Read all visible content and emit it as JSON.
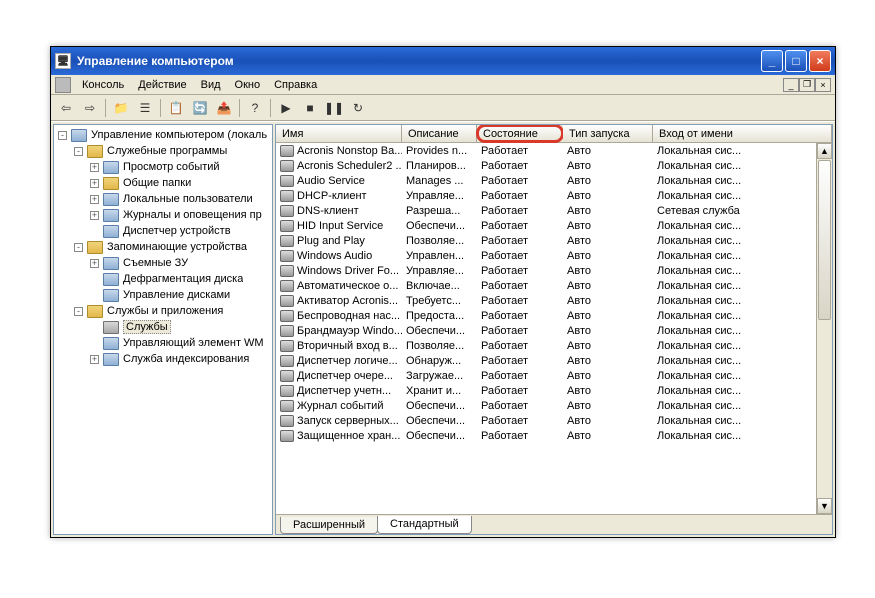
{
  "titlebar": {
    "title": "Управление компьютером"
  },
  "menu": [
    "Консоль",
    "Действие",
    "Вид",
    "Окно",
    "Справка"
  ],
  "tree": [
    {
      "depth": 0,
      "exp": "-",
      "icon": "device",
      "label": "Управление компьютером (локаль"
    },
    {
      "depth": 1,
      "exp": "-",
      "icon": "folder",
      "label": "Служебные программы"
    },
    {
      "depth": 2,
      "exp": "+",
      "icon": "device",
      "label": "Просмотр событий"
    },
    {
      "depth": 2,
      "exp": "+",
      "icon": "folder",
      "label": "Общие папки"
    },
    {
      "depth": 2,
      "exp": "+",
      "icon": "device",
      "label": "Локальные пользователи"
    },
    {
      "depth": 2,
      "exp": "+",
      "icon": "device",
      "label": "Журналы и оповещения пр"
    },
    {
      "depth": 2,
      "exp": " ",
      "icon": "device",
      "label": "Диспетчер устройств"
    },
    {
      "depth": 1,
      "exp": "-",
      "icon": "folder",
      "label": "Запоминающие устройства"
    },
    {
      "depth": 2,
      "exp": "+",
      "icon": "device",
      "label": "Съемные ЗУ"
    },
    {
      "depth": 2,
      "exp": " ",
      "icon": "device",
      "label": "Дефрагментация диска"
    },
    {
      "depth": 2,
      "exp": " ",
      "icon": "device",
      "label": "Управление дисками"
    },
    {
      "depth": 1,
      "exp": "-",
      "icon": "folder",
      "label": "Службы и приложения"
    },
    {
      "depth": 2,
      "exp": " ",
      "icon": "service",
      "label": "Службы",
      "selected": true
    },
    {
      "depth": 2,
      "exp": " ",
      "icon": "device",
      "label": "Управляющий элемент WM"
    },
    {
      "depth": 2,
      "exp": "+",
      "icon": "device",
      "label": "Служба индексирования"
    }
  ],
  "columns": {
    "name": "Имя",
    "desc": "Описание",
    "status": "Состояние",
    "startup": "Тип запуска",
    "logon": "Вход от имени"
  },
  "services": [
    {
      "name": "Acronis Nonstop Ba...",
      "desc": "Provides n...",
      "status": "Работает",
      "startup": "Авто",
      "logon": "Локальная сис..."
    },
    {
      "name": "Acronis Scheduler2 ...",
      "desc": "Планиров...",
      "status": "Работает",
      "startup": "Авто",
      "logon": "Локальная сис..."
    },
    {
      "name": "Audio Service",
      "desc": "Manages ...",
      "status": "Работает",
      "startup": "Авто",
      "logon": "Локальная сис..."
    },
    {
      "name": "DHCP-клиент",
      "desc": "Управляе...",
      "status": "Работает",
      "startup": "Авто",
      "logon": "Локальная сис..."
    },
    {
      "name": "DNS-клиент",
      "desc": "Разреша...",
      "status": "Работает",
      "startup": "Авто",
      "logon": "Сетевая служба"
    },
    {
      "name": "HID Input Service",
      "desc": "Обеспечи...",
      "status": "Работает",
      "startup": "Авто",
      "logon": "Локальная сис..."
    },
    {
      "name": "Plug and Play",
      "desc": "Позволяе...",
      "status": "Работает",
      "startup": "Авто",
      "logon": "Локальная сис..."
    },
    {
      "name": "Windows Audio",
      "desc": "Управлен...",
      "status": "Работает",
      "startup": "Авто",
      "logon": "Локальная сис..."
    },
    {
      "name": "Windows Driver Fo...",
      "desc": "Управляе...",
      "status": "Работает",
      "startup": "Авто",
      "logon": "Локальная сис..."
    },
    {
      "name": "Автоматическое о...",
      "desc": "Включае...",
      "status": "Работает",
      "startup": "Авто",
      "logon": "Локальная сис..."
    },
    {
      "name": "Активатор Acronis...",
      "desc": "Требуетс...",
      "status": "Работает",
      "startup": "Авто",
      "logon": "Локальная сис..."
    },
    {
      "name": "Беспроводная нас...",
      "desc": "Предоста...",
      "status": "Работает",
      "startup": "Авто",
      "logon": "Локальная сис..."
    },
    {
      "name": "Брандмауэр Windo...",
      "desc": "Обеспечи...",
      "status": "Работает",
      "startup": "Авто",
      "logon": "Локальная сис..."
    },
    {
      "name": "Вторичный вход в...",
      "desc": "Позволяе...",
      "status": "Работает",
      "startup": "Авто",
      "logon": "Локальная сис..."
    },
    {
      "name": "Диспетчер логиче...",
      "desc": "Обнаруж...",
      "status": "Работает",
      "startup": "Авто",
      "logon": "Локальная сис..."
    },
    {
      "name": "Диспетчер очере...",
      "desc": "Загружае...",
      "status": "Работает",
      "startup": "Авто",
      "logon": "Локальная сис..."
    },
    {
      "name": "Диспетчер учетн...",
      "desc": "Хранит и...",
      "status": "Работает",
      "startup": "Авто",
      "logon": "Локальная сис..."
    },
    {
      "name": "Журнал событий",
      "desc": "Обеспечи...",
      "status": "Работает",
      "startup": "Авто",
      "logon": "Локальная сис..."
    },
    {
      "name": "Запуск серверных...",
      "desc": "Обеспечи...",
      "status": "Работает",
      "startup": "Авто",
      "logon": "Локальная сис..."
    },
    {
      "name": "Защищенное хран...",
      "desc": "Обеспечи...",
      "status": "Работает",
      "startup": "Авто",
      "logon": "Локальная сис..."
    }
  ],
  "tabs": {
    "extended": "Расширенный",
    "standard": "Стандартный"
  }
}
